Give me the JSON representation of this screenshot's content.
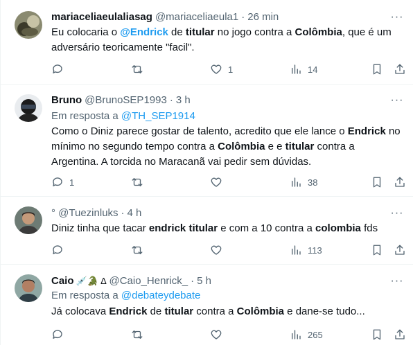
{
  "tweets": [
    {
      "name": "mariaceliaeulaliasag",
      "handle": "@mariaceliaeula1",
      "dot": "·",
      "time": "26 min",
      "reply_prefix": "",
      "reply_handle": "",
      "body_parts": [
        {
          "t": "Eu colocaria o ",
          "s": "n"
        },
        {
          "t": "@Endrick",
          "s": "lb"
        },
        {
          "t": " de ",
          "s": "n"
        },
        {
          "t": "titular",
          "s": "b"
        },
        {
          "t": " no jogo contra a ",
          "s": "n"
        },
        {
          "t": "Colômbia",
          "s": "b"
        },
        {
          "t": ", que é um adversário teoricamente  \"facil\".",
          "s": "n"
        }
      ],
      "replies": "",
      "retweets": "",
      "likes": "1",
      "views": "14"
    },
    {
      "name": "Bruno",
      "handle": "@BrunoSEP1993",
      "dot": "·",
      "time": "3 h",
      "reply_prefix": "Em resposta a ",
      "reply_handle": "@TH_SEP1914",
      "body_parts": [
        {
          "t": "Como o Diniz parece gostar de talento, acredito que ele lance o ",
          "s": "n"
        },
        {
          "t": "Endrick",
          "s": "b"
        },
        {
          "t": " no mínimo no segundo tempo contra a ",
          "s": "n"
        },
        {
          "t": "Colômbia",
          "s": "b"
        },
        {
          "t": " e e ",
          "s": "n"
        },
        {
          "t": "titular",
          "s": "b"
        },
        {
          "t": " contra a Argentina. A torcida no Maracanã vai pedir sem dúvidas.",
          "s": "n"
        }
      ],
      "replies": "1",
      "retweets": "",
      "likes": "",
      "views": "38"
    },
    {
      "name": "",
      "handle": "° @Tuezinluks",
      "dot": "·",
      "time": "4 h",
      "reply_prefix": "",
      "reply_handle": "",
      "body_parts": [
        {
          "t": "Diniz tinha que tacar ",
          "s": "n"
        },
        {
          "t": "endrick titular",
          "s": "b"
        },
        {
          "t": " e com a 10 contra a ",
          "s": "n"
        },
        {
          "t": "colombia",
          "s": "b"
        },
        {
          "t": " fds",
          "s": "n"
        }
      ],
      "replies": "",
      "retweets": "",
      "likes": "",
      "views": "113"
    },
    {
      "name": "Caio",
      "handle": "@Caio_Henrick_",
      "dot": "·",
      "time": "5 h",
      "name_emoji": "💉🐊 ∆",
      "reply_prefix": "Em resposta a ",
      "reply_handle": "@debateydebate",
      "body_parts": [
        {
          "t": "Já colocava ",
          "s": "n"
        },
        {
          "t": "Endrick",
          "s": "b"
        },
        {
          "t": " de ",
          "s": "n"
        },
        {
          "t": "titular",
          "s": "b"
        },
        {
          "t": " contra a ",
          "s": "n"
        },
        {
          "t": "Colômbia",
          "s": "b"
        },
        {
          "t": " e dane-se tudo...",
          "s": "n"
        }
      ],
      "replies": "",
      "retweets": "",
      "likes": "",
      "views": "265"
    }
  ],
  "icons": {
    "more": "more-dots-icon",
    "reply": "reply-bubble-icon",
    "retweet": "retweet-arrows-icon",
    "like": "heart-icon",
    "views": "views-bars-icon",
    "bookmark": "bookmark-icon",
    "share": "share-upload-icon"
  },
  "colors": {
    "link": "#1d9bf0",
    "text": "#0f1419",
    "muted": "#536471",
    "divider": "#eff3f4"
  }
}
